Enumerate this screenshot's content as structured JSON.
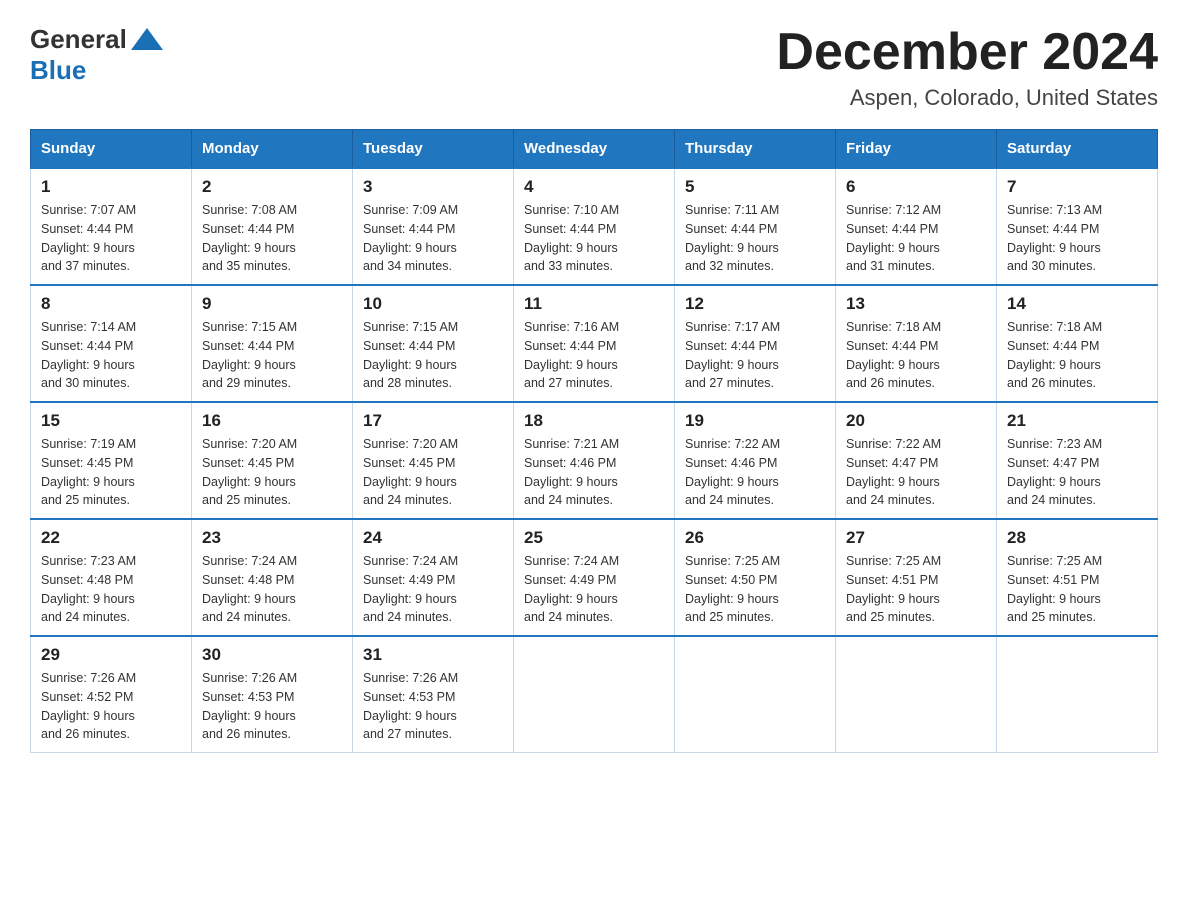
{
  "header": {
    "logo_general": "General",
    "logo_blue": "Blue",
    "month_title": "December 2024",
    "location": "Aspen, Colorado, United States"
  },
  "weekdays": [
    "Sunday",
    "Monday",
    "Tuesday",
    "Wednesday",
    "Thursday",
    "Friday",
    "Saturday"
  ],
  "weeks": [
    [
      {
        "day": "1",
        "sunrise": "7:07 AM",
        "sunset": "4:44 PM",
        "daylight": "9 hours and 37 minutes."
      },
      {
        "day": "2",
        "sunrise": "7:08 AM",
        "sunset": "4:44 PM",
        "daylight": "9 hours and 35 minutes."
      },
      {
        "day": "3",
        "sunrise": "7:09 AM",
        "sunset": "4:44 PM",
        "daylight": "9 hours and 34 minutes."
      },
      {
        "day": "4",
        "sunrise": "7:10 AM",
        "sunset": "4:44 PM",
        "daylight": "9 hours and 33 minutes."
      },
      {
        "day": "5",
        "sunrise": "7:11 AM",
        "sunset": "4:44 PM",
        "daylight": "9 hours and 32 minutes."
      },
      {
        "day": "6",
        "sunrise": "7:12 AM",
        "sunset": "4:44 PM",
        "daylight": "9 hours and 31 minutes."
      },
      {
        "day": "7",
        "sunrise": "7:13 AM",
        "sunset": "4:44 PM",
        "daylight": "9 hours and 30 minutes."
      }
    ],
    [
      {
        "day": "8",
        "sunrise": "7:14 AM",
        "sunset": "4:44 PM",
        "daylight": "9 hours and 30 minutes."
      },
      {
        "day": "9",
        "sunrise": "7:15 AM",
        "sunset": "4:44 PM",
        "daylight": "9 hours and 29 minutes."
      },
      {
        "day": "10",
        "sunrise": "7:15 AM",
        "sunset": "4:44 PM",
        "daylight": "9 hours and 28 minutes."
      },
      {
        "day": "11",
        "sunrise": "7:16 AM",
        "sunset": "4:44 PM",
        "daylight": "9 hours and 27 minutes."
      },
      {
        "day": "12",
        "sunrise": "7:17 AM",
        "sunset": "4:44 PM",
        "daylight": "9 hours and 27 minutes."
      },
      {
        "day": "13",
        "sunrise": "7:18 AM",
        "sunset": "4:44 PM",
        "daylight": "9 hours and 26 minutes."
      },
      {
        "day": "14",
        "sunrise": "7:18 AM",
        "sunset": "4:44 PM",
        "daylight": "9 hours and 26 minutes."
      }
    ],
    [
      {
        "day": "15",
        "sunrise": "7:19 AM",
        "sunset": "4:45 PM",
        "daylight": "9 hours and 25 minutes."
      },
      {
        "day": "16",
        "sunrise": "7:20 AM",
        "sunset": "4:45 PM",
        "daylight": "9 hours and 25 minutes."
      },
      {
        "day": "17",
        "sunrise": "7:20 AM",
        "sunset": "4:45 PM",
        "daylight": "9 hours and 24 minutes."
      },
      {
        "day": "18",
        "sunrise": "7:21 AM",
        "sunset": "4:46 PM",
        "daylight": "9 hours and 24 minutes."
      },
      {
        "day": "19",
        "sunrise": "7:22 AM",
        "sunset": "4:46 PM",
        "daylight": "9 hours and 24 minutes."
      },
      {
        "day": "20",
        "sunrise": "7:22 AM",
        "sunset": "4:47 PM",
        "daylight": "9 hours and 24 minutes."
      },
      {
        "day": "21",
        "sunrise": "7:23 AM",
        "sunset": "4:47 PM",
        "daylight": "9 hours and 24 minutes."
      }
    ],
    [
      {
        "day": "22",
        "sunrise": "7:23 AM",
        "sunset": "4:48 PM",
        "daylight": "9 hours and 24 minutes."
      },
      {
        "day": "23",
        "sunrise": "7:24 AM",
        "sunset": "4:48 PM",
        "daylight": "9 hours and 24 minutes."
      },
      {
        "day": "24",
        "sunrise": "7:24 AM",
        "sunset": "4:49 PM",
        "daylight": "9 hours and 24 minutes."
      },
      {
        "day": "25",
        "sunrise": "7:24 AM",
        "sunset": "4:49 PM",
        "daylight": "9 hours and 24 minutes."
      },
      {
        "day": "26",
        "sunrise": "7:25 AM",
        "sunset": "4:50 PM",
        "daylight": "9 hours and 25 minutes."
      },
      {
        "day": "27",
        "sunrise": "7:25 AM",
        "sunset": "4:51 PM",
        "daylight": "9 hours and 25 minutes."
      },
      {
        "day": "28",
        "sunrise": "7:25 AM",
        "sunset": "4:51 PM",
        "daylight": "9 hours and 25 minutes."
      }
    ],
    [
      {
        "day": "29",
        "sunrise": "7:26 AM",
        "sunset": "4:52 PM",
        "daylight": "9 hours and 26 minutes."
      },
      {
        "day": "30",
        "sunrise": "7:26 AM",
        "sunset": "4:53 PM",
        "daylight": "9 hours and 26 minutes."
      },
      {
        "day": "31",
        "sunrise": "7:26 AM",
        "sunset": "4:53 PM",
        "daylight": "9 hours and 27 minutes."
      },
      null,
      null,
      null,
      null
    ]
  ],
  "labels": {
    "sunrise": "Sunrise:",
    "sunset": "Sunset:",
    "daylight": "Daylight:"
  }
}
